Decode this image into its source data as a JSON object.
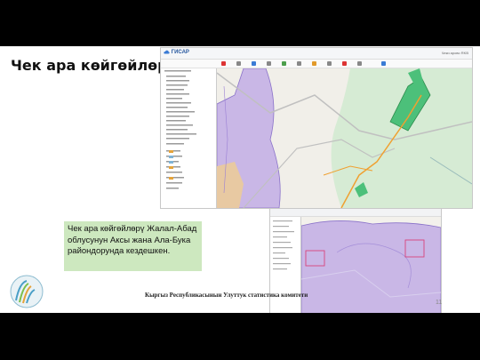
{
  "slide": {
    "title": "Чек ара көйгөйлөрү",
    "caption": "Чек ара көйгөйлөрү Жалал-Абад облусунун Аксы жана Ала-Бука райондорунда кездешкен.",
    "footer": "Кыргыз Республикасынын Улуттук статистика комитети",
    "page_number": "11"
  },
  "gis_app": {
    "logo_text": "ГИСАР",
    "top_right_text": "Чеки арово  RKB",
    "colors": {
      "header_blue": "#2a5aa0",
      "map_purple": "#c9b7e6",
      "map_green": "#d4ecd0",
      "zone_green": "#4cc07a",
      "road_orange": "#f0a030"
    }
  },
  "icons": [
    "cloud-logo-icon",
    "toolbar-icon",
    "layer-checkbox-icon",
    "layer-swatch-icon",
    "highlight-box-icon"
  ]
}
